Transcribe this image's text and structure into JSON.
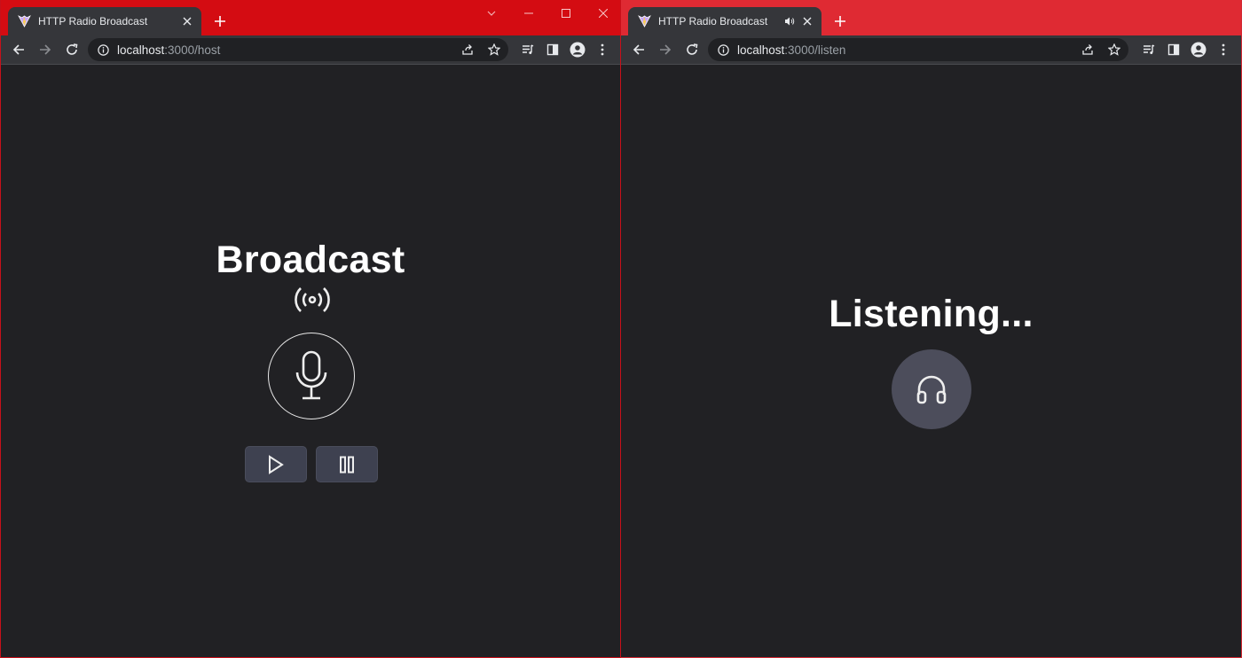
{
  "windows": [
    {
      "tab": {
        "title": "HTTP Radio Broadcast",
        "favicon": "vite-logo-icon"
      },
      "url": {
        "host": "localhost",
        "path": ":3000/host"
      },
      "page": {
        "heading": "Broadcast",
        "signal_icon": "broadcast-signal-icon",
        "mic_icon": "microphone-icon",
        "play_icon": "play-icon",
        "pause_icon": "pause-icon"
      },
      "theme": {
        "frame": "#d40c12"
      }
    },
    {
      "tab": {
        "title": "HTTP Radio Broadcast",
        "favicon": "vite-logo-icon",
        "audio_icon": "speaker-icon"
      },
      "url": {
        "host": "localhost",
        "path": ":3000/listen"
      },
      "page": {
        "heading": "Listening...",
        "headphone_icon": "headphones-icon"
      },
      "theme": {
        "frame": "#df2a33"
      }
    }
  ],
  "theme": {
    "background": "#212124",
    "toolbar": "#35363a",
    "button": "#3e4150",
    "headphone_circle": "#4c4d5b",
    "text": "#ffffff"
  }
}
